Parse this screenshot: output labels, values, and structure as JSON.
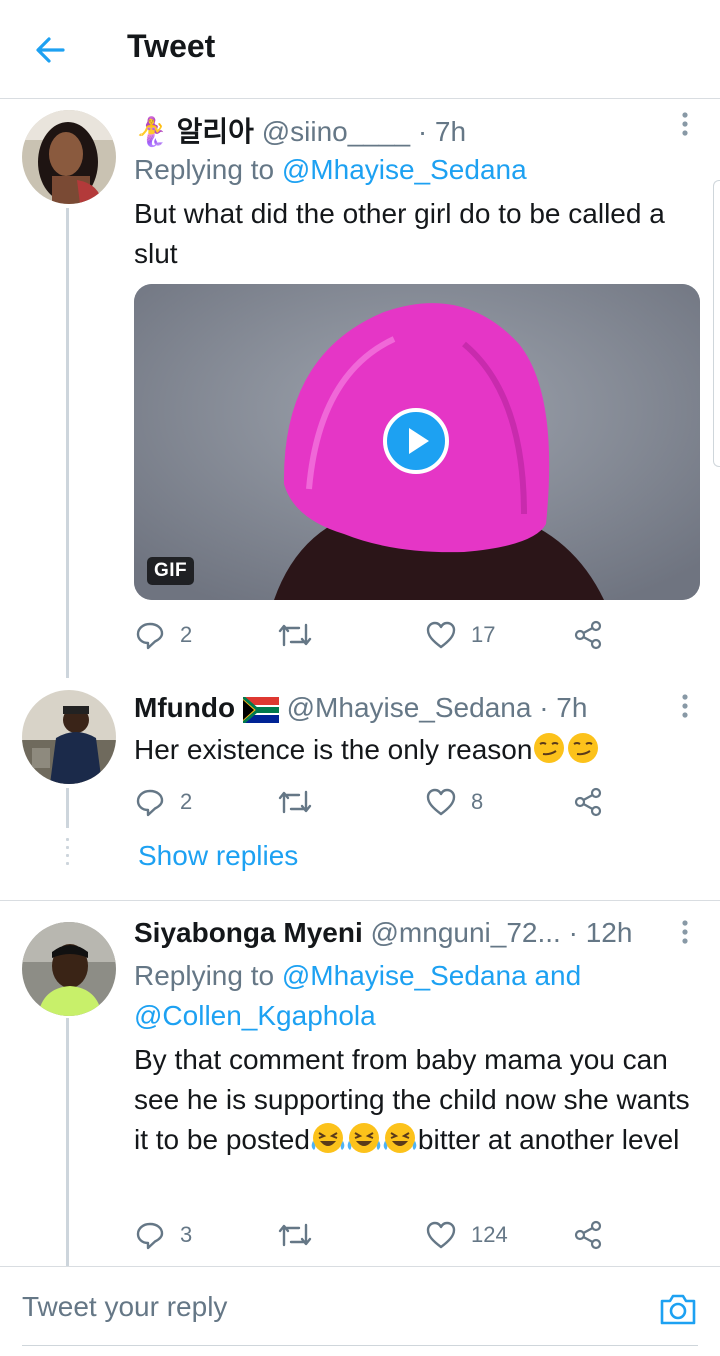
{
  "header": {
    "title": "Tweet"
  },
  "tweets": [
    {
      "name": "🧜‍♀️ 알리아",
      "handle": "@siino____",
      "time": "· 7h",
      "replying_prefix": "Replying to ",
      "replying_to": "@Mhayise_Sedana",
      "text": "But what did the other girl do to be called a slut",
      "media": {
        "badge": "GIF"
      },
      "replies": "2",
      "likes": "17"
    },
    {
      "name": "Mfundo",
      "handle": "@Mhayise_Sedana",
      "time": "· 7h",
      "text": "Her existence is the only reason",
      "replies": "2",
      "likes": "8",
      "show_replies": "Show replies"
    },
    {
      "name": "Siyabonga Myeni",
      "handle": "@mnguni_72...",
      "time": "· 12h",
      "replying_prefix": "Replying to ",
      "replying_to": "@Mhayise_Sedana and @Collen_Kgaphola",
      "text_before": "By that comment from baby mama you can see he is supporting the child now she wants it  to be posted",
      "text_after": "bitter at another level",
      "replies": "3",
      "likes": "124"
    }
  ],
  "compose": {
    "placeholder": "Tweet your reply"
  },
  "colors": {
    "accent": "#1da1f2",
    "muted": "#657786",
    "divider": "#d9dde1"
  }
}
